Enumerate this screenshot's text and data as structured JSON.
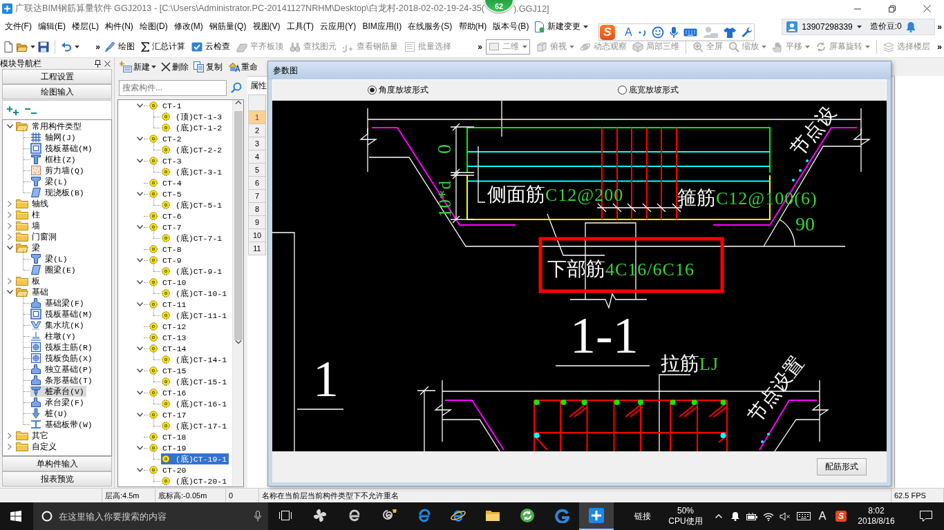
{
  "window": {
    "title_start": "广联达BIM钢筋算量软件 GGJ2013 - [C:\\Users\\Administrator.PC-20141127NRHM\\Desktop\\白龙村-2018-02-02-19-24-35(",
    "title_end": ").GGJ12]",
    "badge": "62"
  },
  "menu": {
    "items": [
      "文件(F)",
      "编辑(E)",
      "楼层(L)",
      "构件(N)",
      "绘图(D)",
      "修改(M)",
      "钢筋量(Q)",
      "视图(V)",
      "工具(T)",
      "云应用(Y)",
      "BIM应用(I)",
      "在线服务(S)",
      "帮助(H)",
      "版本号(B)"
    ],
    "new_change": "新建变更",
    "account": "13907298339",
    "beans": "造价豆:0",
    "overflow": "»"
  },
  "ime_toolbar": {
    "logo": "S",
    "mode": "A"
  },
  "toolbar": {
    "file_overflow": "»",
    "draw_items": [
      {
        "label": "绘图",
        "disabled": false
      },
      {
        "label": "汇总计算",
        "disabled": false
      },
      {
        "label": "云检查",
        "disabled": false
      },
      {
        "label": "平齐板顶",
        "disabled": true
      },
      {
        "label": "查找图元",
        "disabled": true
      },
      {
        "label": "查看钢筋量",
        "disabled": true
      },
      {
        "label": "批量选择",
        "disabled": true
      }
    ],
    "draw_overflow": "»",
    "view_mode": {
      "value": "二维",
      "disabled": true
    },
    "view_groups": [
      [
        {
          "label": "俯视",
          "dropdown": true,
          "disabled": true
        },
        {
          "label": "动态观察",
          "dropdown": false,
          "disabled": true
        },
        {
          "label": "局部三维",
          "dropdown": false,
          "disabled": true
        }
      ],
      [
        {
          "label": "全屏",
          "dropdown": false,
          "disabled": true
        },
        {
          "label": "缩放",
          "dropdown": true,
          "disabled": true
        },
        {
          "label": "平移",
          "dropdown": true,
          "disabled": true
        },
        {
          "label": "屏幕旋转",
          "dropdown": true,
          "disabled": true
        }
      ],
      [
        {
          "label": "选择楼层",
          "dropdown": false,
          "disabled": true
        }
      ]
    ],
    "view_overflow": "»"
  },
  "nav_panel": {
    "title": "模块导航栏",
    "sections_top": [
      "工程设置",
      "绘图输入"
    ],
    "tree": [
      {
        "label": "常用构件类型",
        "expanded": true,
        "selected": false,
        "children": [
          {
            "label": "轴网(J)",
            "selected": false
          },
          {
            "label": "筏板基础(M)",
            "selected": false
          },
          {
            "label": "框柱(Z)",
            "selected": false
          },
          {
            "label": "剪力墙(Q)",
            "selected": false
          },
          {
            "label": "梁(L)",
            "selected": false
          },
          {
            "label": "现浇板(B)",
            "selected": false
          }
        ]
      },
      {
        "label": "轴线",
        "expanded": false,
        "selected": false
      },
      {
        "label": "柱",
        "expanded": false,
        "selected": false
      },
      {
        "label": "墙",
        "expanded": false,
        "selected": false
      },
      {
        "label": "门窗洞",
        "expanded": false,
        "selected": false
      },
      {
        "label": "梁",
        "expanded": true,
        "selected": false,
        "children": [
          {
            "label": "梁(L)",
            "selected": false
          },
          {
            "label": "圈梁(E)",
            "selected": false
          }
        ]
      },
      {
        "label": "板",
        "expanded": false,
        "selected": false
      },
      {
        "label": "基础",
        "expanded": true,
        "selected": false,
        "children": [
          {
            "label": "基础梁(F)",
            "selected": false
          },
          {
            "label": "筏板基础(M)",
            "selected": false
          },
          {
            "label": "集水坑(K)",
            "selected": false
          },
          {
            "label": "柱墩(Y)",
            "selected": false
          },
          {
            "label": "筏板主筋(R)",
            "selected": false
          },
          {
            "label": "筏板负筋(X)",
            "selected": false
          },
          {
            "label": "独立基础(P)",
            "selected": false
          },
          {
            "label": "条形基础(T)",
            "selected": false
          },
          {
            "label": "桩承台(V)",
            "selected": true
          },
          {
            "label": "承台梁(F)",
            "selected": false
          },
          {
            "label": "桩(U)",
            "selected": false
          },
          {
            "label": "基础板带(W)",
            "selected": false
          }
        ]
      },
      {
        "label": "其它",
        "expanded": false,
        "selected": false
      },
      {
        "label": "自定义",
        "expanded": false,
        "selected": false
      }
    ],
    "sections_bottom": [
      "单构件输入",
      "报表预览"
    ]
  },
  "component_panel": {
    "actions": [
      {
        "label": "新建",
        "dropdown": true
      },
      {
        "label": "删除",
        "dropdown": false
      },
      {
        "label": "复制",
        "dropdown": false
      },
      {
        "label": "重命",
        "dropdown": false
      }
    ],
    "search": {
      "placeholder": "搜索构件..."
    },
    "tree": [
      {
        "label": "CT-1",
        "expanded": true,
        "selected": false,
        "children": [
          {
            "label": "(顶)CT-1-3",
            "selected": false
          },
          {
            "label": "(底)CT-1-2",
            "selected": false
          }
        ]
      },
      {
        "label": "CT-2",
        "expanded": true,
        "selected": false,
        "children": [
          {
            "label": "(底)CT-2-2",
            "selected": false
          }
        ]
      },
      {
        "label": "CT-3",
        "expanded": true,
        "selected": false,
        "children": [
          {
            "label": "(底)CT-3-1",
            "selected": false
          }
        ]
      },
      {
        "label": "CT-4",
        "selected": false
      },
      {
        "label": "CT-5",
        "expanded": true,
        "selected": false,
        "children": [
          {
            "label": "(底)CT-5-1",
            "selected": false
          }
        ]
      },
      {
        "label": "CT-6",
        "selected": false
      },
      {
        "label": "CT-7",
        "expanded": true,
        "selected": false,
        "children": [
          {
            "label": "(底)CT-7-1",
            "selected": false
          }
        ]
      },
      {
        "label": "CT-8",
        "selected": false
      },
      {
        "label": "CT-9",
        "expanded": true,
        "selected": false,
        "children": [
          {
            "label": "(底)CT-9-1",
            "selected": false
          }
        ]
      },
      {
        "label": "CT-10",
        "expanded": true,
        "selected": false,
        "children": [
          {
            "label": "(底)CT-10-1",
            "selected": false
          }
        ]
      },
      {
        "label": "CT-11",
        "expanded": true,
        "selected": false,
        "children": [
          {
            "label": "(底)CT-11-1",
            "selected": false
          }
        ]
      },
      {
        "label": "CT-12",
        "selected": false
      },
      {
        "label": "CT-13",
        "selected": false
      },
      {
        "label": "CT-14",
        "expanded": true,
        "selected": false,
        "children": [
          {
            "label": "(底)CT-14-1",
            "selected": false
          }
        ]
      },
      {
        "label": "CT-15",
        "expanded": true,
        "selected": false,
        "children": [
          {
            "label": "(底)CT-15-1",
            "selected": false
          }
        ]
      },
      {
        "label": "CT-16",
        "expanded": true,
        "selected": false,
        "children": [
          {
            "label": "(底)CT-16-1",
            "selected": false
          }
        ]
      },
      {
        "label": "CT-17",
        "expanded": true,
        "selected": false,
        "children": [
          {
            "label": "(底)CT-17-1",
            "selected": false
          }
        ]
      },
      {
        "label": "CT-18",
        "selected": false
      },
      {
        "label": "CT-19",
        "expanded": true,
        "selected": false,
        "children": [
          {
            "label": "(底)CT-19-1",
            "selected": true
          }
        ]
      },
      {
        "label": "CT-20",
        "expanded": true,
        "selected": false,
        "children": [
          {
            "label": "(底)CT-20-1",
            "selected": false
          }
        ]
      }
    ]
  },
  "properties_panel": {
    "tab": "属性",
    "rows": [
      {
        "number": "1",
        "selected": true
      },
      {
        "number": "2",
        "selected": false
      },
      {
        "number": "3",
        "selected": false
      },
      {
        "number": "4",
        "selected": false
      },
      {
        "number": "5",
        "selected": false
      },
      {
        "number": "6",
        "selected": false
      },
      {
        "number": "7",
        "selected": false
      },
      {
        "number": "8",
        "selected": false
      },
      {
        "number": "9",
        "selected": false
      },
      {
        "number": "10",
        "selected": false
      },
      {
        "number": "11",
        "selected": false
      }
    ]
  },
  "dialog": {
    "title": "参数图",
    "options": [
      {
        "label": "角度放坡形式",
        "selected": true
      },
      {
        "label": "底宽放坡形式",
        "selected": false
      }
    ],
    "drawing": {
      "side_bar": {
        "label": "侧面筋",
        "spec": "C12@200"
      },
      "stirrup": {
        "label": "箍筋",
        "spec": "C12@100(6)"
      },
      "bottom_bar": {
        "label": "下部筋",
        "spec": "4C16/6C16",
        "highlighted": true
      },
      "tie": {
        "label": "拉筋",
        "spec": "LJ"
      },
      "slope_angle": "90",
      "cover": "0",
      "anchorage": "10*d",
      "section_title": "1-1",
      "plan_mark": "1",
      "node_note_upper": "节点设",
      "node_note_lower": "节点设置"
    },
    "button": "配筋形式"
  },
  "status_bar": {
    "fields": [
      "层高:4.5m",
      "底标高:-0.05m",
      "0"
    ],
    "message": "名称在当前层当前构件类型下不允许重名",
    "fps": "62.5 FPS"
  },
  "taskbar": {
    "search_placeholder": "在这里输入你要搜索的内容",
    "apps": [
      {
        "selected": false
      },
      {
        "selected": false
      },
      {
        "selected": false
      },
      {
        "selected": false
      },
      {
        "selected": false
      },
      {
        "selected": false
      },
      {
        "selected": false
      },
      {
        "selected": false
      },
      {
        "selected": true
      }
    ],
    "links": "链接",
    "cpu_value": "50%",
    "cpu_label": "CPU使用",
    "ime_mode": "A",
    "ime_logo": "S",
    "time": "8:02",
    "date": "2018/8/16"
  }
}
